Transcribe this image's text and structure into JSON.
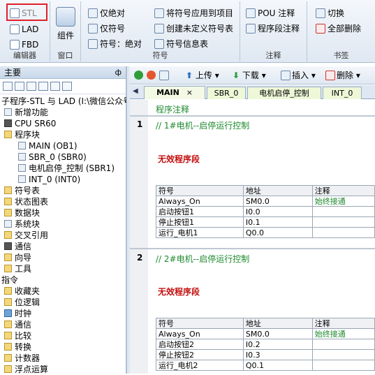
{
  "ribbon": {
    "editor_group": {
      "label": "编辑器",
      "stl": "STL",
      "lad": "LAD",
      "fbd": "FBD"
    },
    "window_group": {
      "label": "窗口",
      "component": "组件"
    },
    "symbol_group": {
      "label": "符号",
      "only_absolute": "仅绝对",
      "only_symbol": "仅符号",
      "symbol_absolute": "符号：绝对",
      "apply_symbols": "将符号应用到项目",
      "create_undefined": "创建未定义符号表",
      "symbol_info": "符号信息表"
    },
    "comment_group": {
      "label": "注释",
      "pou_comment": "POU 注释",
      "segment_comment": "程序段注释"
    },
    "bookmark_group": {
      "label": "书签",
      "toggle": "切换",
      "delete_all": "全部删除"
    }
  },
  "sidebar": {
    "header": "主要",
    "pin": "ф",
    "project": "子程序-STL 与 LAD (I:\\微信公众号",
    "items": [
      "新增功能",
      "CPU SR60",
      "程序块",
      "MAIN (OB1)",
      "SBR_0 (SBR0)",
      "电机启停_控制 (SBR1)",
      "INT_0 (INT0)",
      "符号表",
      "状态图表",
      "数据块",
      "系统块",
      "交叉引用",
      "通信",
      "向导",
      "工具",
      "指令",
      "收藏夹",
      "位逻辑",
      "时钟",
      "通信",
      "比较",
      "转换",
      "计数器",
      "浮点运算"
    ]
  },
  "toolbar": {
    "upload": "上传",
    "download": "下载",
    "insert": "插入",
    "delete": "删除"
  },
  "tabs": [
    "MAIN",
    "SBR_0",
    "电机启停_控制",
    "INT_0"
  ],
  "tab_close": "×",
  "tab_scroll": "◀",
  "editor": {
    "program_comment": "程序注释",
    "networks": [
      {
        "num": "1",
        "comment": "// 1#电机--启停运行控制",
        "invalid": "无效程序段",
        "headers": [
          "符号",
          "地址",
          "注释"
        ],
        "rows": [
          [
            "Always_On",
            "SM0.0",
            "始终接通"
          ],
          [
            "启动按钮1",
            "I0.0",
            ""
          ],
          [
            "停止按钮1",
            "I0.1",
            ""
          ],
          [
            "运行_电机1",
            "Q0.0",
            ""
          ]
        ]
      },
      {
        "num": "2",
        "comment": "// 2#电机--启停运行控制",
        "invalid": "无效程序段",
        "headers": [
          "符号",
          "地址",
          "注释"
        ],
        "rows": [
          [
            "Always_On",
            "SM0.0",
            "始终接通"
          ],
          [
            "启动按钮2",
            "I0.2",
            ""
          ],
          [
            "停止按钮2",
            "I0.3",
            ""
          ],
          [
            "运行_电机2",
            "Q0.1",
            ""
          ]
        ]
      }
    ]
  }
}
